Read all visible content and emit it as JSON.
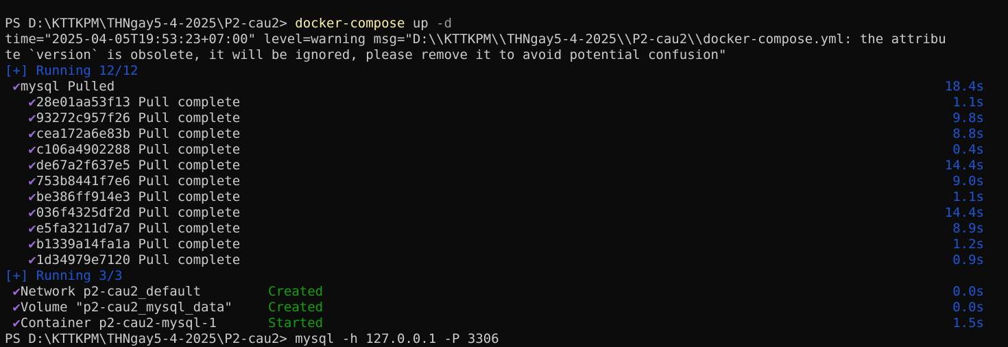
{
  "prompt1": {
    "path": "PS D:\\KTTKPM\\THNgay5-4-2025\\P2-cau2> ",
    "command": "docker-compose",
    "args_plain": " up ",
    "args_flag": "-d"
  },
  "warning": {
    "line1": "time=\"2025-04-05T19:53:23+07:00\" level=warning msg=\"D:\\\\KTTKPM\\\\THNgay5-4-2025\\\\P2-cau2\\\\docker-compose.yml: the attribu",
    "line2": "te `version` is obsolete, it will be ignored, please remove it to avoid potential confusion\""
  },
  "running1": {
    "label": "[+] Running 12/12"
  },
  "mysql": {
    "label": "mysql Pulled",
    "time": "18.4s"
  },
  "layers": [
    {
      "id": "28e01aa53f13",
      "status": "Pull complete",
      "time": "1.1s"
    },
    {
      "id": "93272c957f26",
      "status": "Pull complete",
      "time": "9.8s"
    },
    {
      "id": "cea172a6e83b",
      "status": "Pull complete",
      "time": "8.8s"
    },
    {
      "id": "c106a4902288",
      "status": "Pull complete",
      "time": "0.4s"
    },
    {
      "id": "de67a2f637e5",
      "status": "Pull complete",
      "time": "14.4s"
    },
    {
      "id": "753b8441f7e6",
      "status": "Pull complete",
      "time": "9.0s"
    },
    {
      "id": "be386ff914e3",
      "status": "Pull complete",
      "time": "1.1s"
    },
    {
      "id": "036f4325df2d",
      "status": "Pull complete",
      "time": "14.4s"
    },
    {
      "id": "e5fa3211d7a7",
      "status": "Pull complete",
      "time": "8.9s"
    },
    {
      "id": "b1339a14fa1a",
      "status": "Pull complete",
      "time": "1.2s"
    },
    {
      "id": "1d34979e7120",
      "status": "Pull complete",
      "time": "0.9s"
    }
  ],
  "running2": {
    "label": "[+] Running 3/3"
  },
  "resources": [
    {
      "label": "Network p2-cau2_default",
      "status": "Created",
      "time": "0.0s"
    },
    {
      "label": "Volume \"p2-cau2_mysql_data\"",
      "status": "Created",
      "time": "0.0s"
    },
    {
      "label": "Container p2-cau2-mysql-1",
      "status": "Started",
      "time": "1.5s"
    }
  ],
  "check_glyph": "✔",
  "prompt2": {
    "text": "PS D:\\KTTKPM\\THNgay5-4-2025\\P2-cau2> mysql -h 127.0.0.1 -P 3306"
  }
}
